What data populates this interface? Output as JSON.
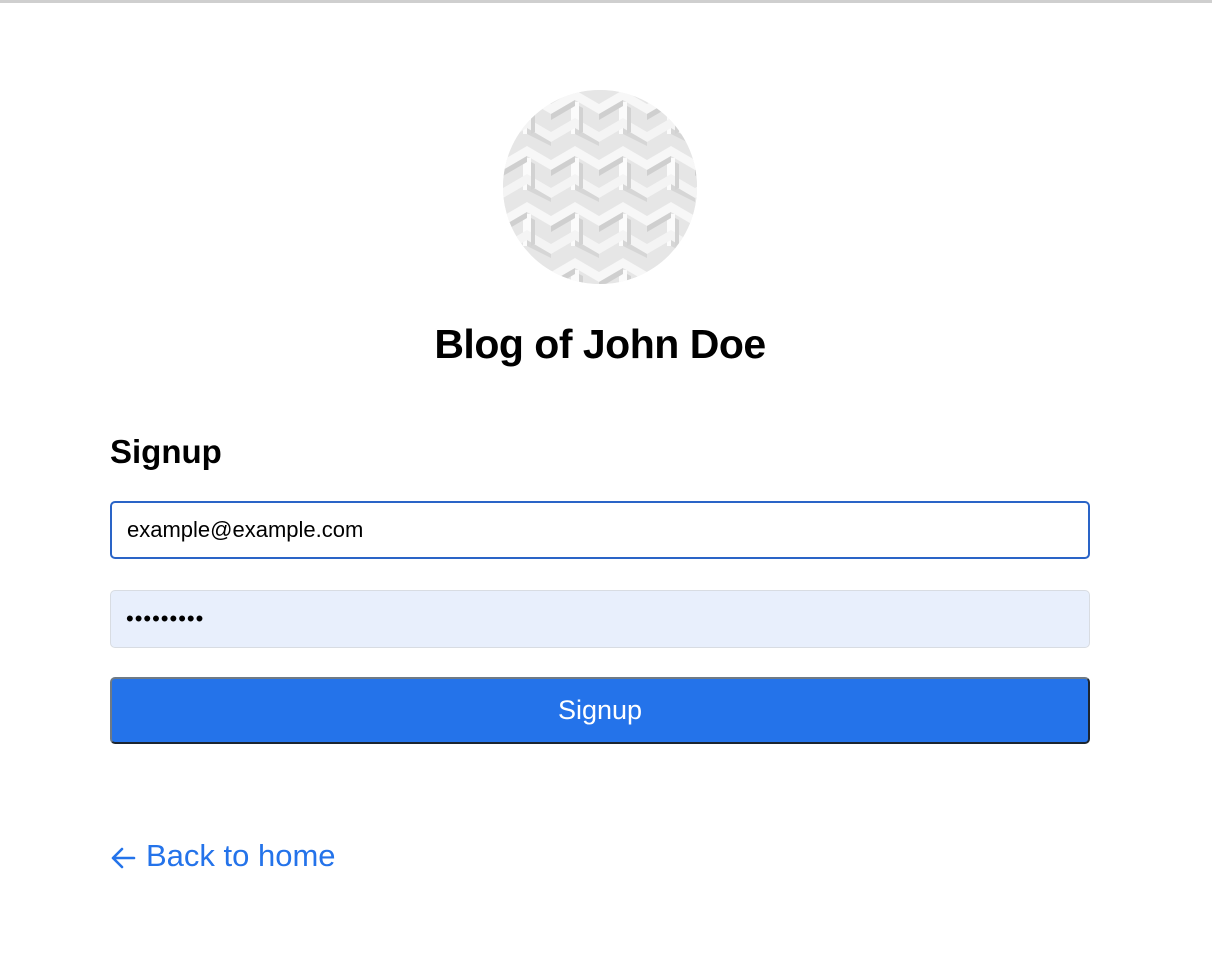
{
  "site": {
    "title": "Blog of John Doe",
    "avatar_icon": "woven-pattern-avatar"
  },
  "form": {
    "title": "Signup",
    "email_value": "example@example.com",
    "password_value": "•••••••••",
    "submit_label": "Signup"
  },
  "footer": {
    "back_label": "Back to home",
    "back_icon": "arrow-left-icon"
  },
  "colors": {
    "accent": "#2473ea",
    "focus_border": "#2a64c7",
    "autofill_bg": "#e8effc"
  }
}
